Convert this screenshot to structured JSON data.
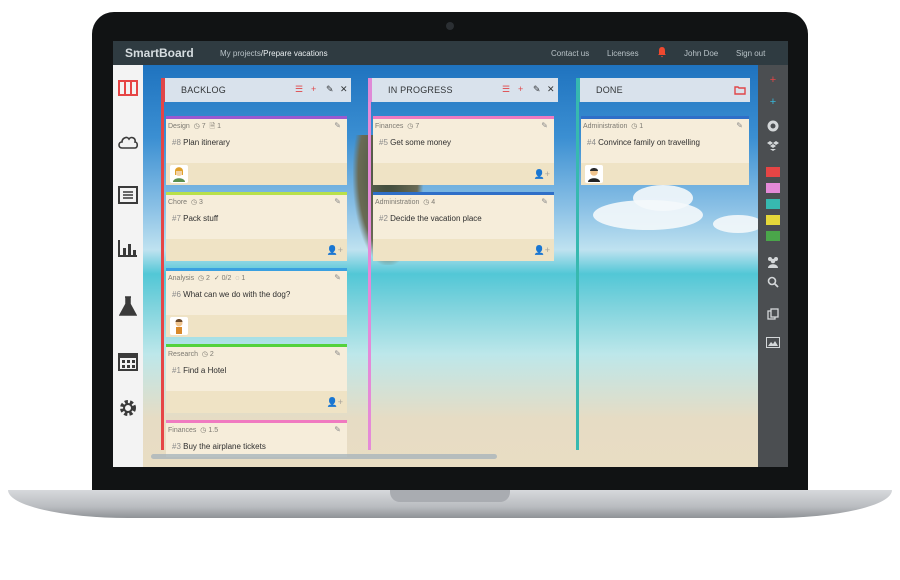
{
  "app": {
    "brand": "SmartBoard",
    "breadcrumb_root": "My projects",
    "breadcrumb_sep": "/",
    "breadcrumb_current": "Prepare vacations"
  },
  "nav": {
    "contact": "Contact us",
    "licenses": "Licenses",
    "user": "John Doe",
    "signout": "Sign out"
  },
  "sidebar": {
    "items": [
      "board-icon",
      "cloud-icon",
      "document-icon",
      "chart-icon",
      "flask-icon",
      "calendar-icon",
      "gear-icon"
    ]
  },
  "columns": [
    {
      "label": "BACKLOG",
      "color": "#e64545"
    },
    {
      "label": "IN PROGRESS",
      "color": "#e58ad8"
    },
    {
      "label": "DONE",
      "color": "#37b9b0"
    }
  ],
  "cards": {
    "backlog": [
      {
        "category": "Design",
        "stat1": "◷ 7",
        "stat2": "🗎 1",
        "stat3": "",
        "num": "#8",
        "title": "Plan itinerary",
        "color": "#9b59d0"
      },
      {
        "category": "Chore",
        "stat1": "◷ 3",
        "stat2": "",
        "stat3": "",
        "num": "#7",
        "title": "Pack stuff",
        "color": "#b9e04a"
      },
      {
        "category": "Analysis",
        "stat1": "◷ 2",
        "stat2": "✓ 0/2",
        "stat3": "◌ 1",
        "num": "#6",
        "title": "What can we do with the dog?",
        "color": "#3aa0e0"
      },
      {
        "category": "Research",
        "stat1": "◷ 2",
        "stat2": "",
        "stat3": "",
        "num": "#1",
        "title": "Find a Hotel",
        "color": "#54d23c"
      },
      {
        "category": "Finances",
        "stat1": "◷ 1.5",
        "stat2": "",
        "stat3": "",
        "num": "#3",
        "title": "Buy the airplane tickets",
        "color": "#f07ac0"
      }
    ],
    "inprogress": [
      {
        "category": "Finances",
        "stat1": "◷ 7",
        "num": "#5",
        "title": "Get some money",
        "color": "#f07ac0"
      },
      {
        "category": "Administration",
        "stat1": "◷ 4",
        "num": "#2",
        "title": "Decide the vacation place",
        "color": "#2f6fc8"
      }
    ],
    "done": [
      {
        "category": "Administration",
        "stat1": "◷ 1",
        "num": "#4",
        "title": "Convince family on travelling",
        "color": "#2f6fc8"
      }
    ]
  }
}
